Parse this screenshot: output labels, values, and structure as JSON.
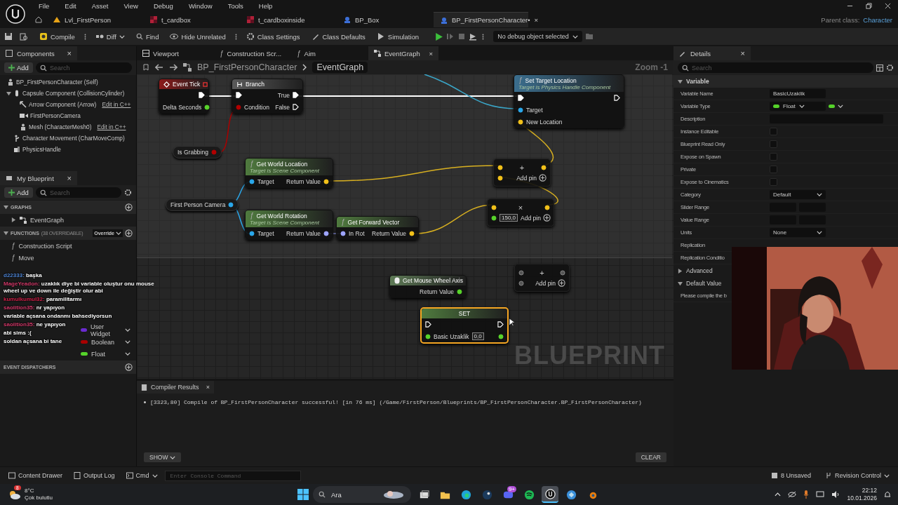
{
  "menu": [
    "File",
    "Edit",
    "Asset",
    "View",
    "Debug",
    "Window",
    "Tools",
    "Help"
  ],
  "doc_tabs": [
    {
      "label": "Lvl_FirstPerson",
      "kind": "level",
      "selected": false
    },
    {
      "label": "t_cardbox",
      "kind": "texture",
      "selected": false
    },
    {
      "label": "t_cardboxinside",
      "kind": "texture",
      "selected": false
    },
    {
      "label": "BP_Box",
      "kind": "blueprint",
      "selected": false
    },
    {
      "label": "BP_FirstPersonCharacter•",
      "kind": "blueprint",
      "selected": true,
      "close": "×"
    }
  ],
  "parent_class": {
    "label": "Parent class:",
    "value": "Character"
  },
  "toolbar": {
    "compile": "Compile",
    "diff": "Diff",
    "find": "Find",
    "hide_unrelated": "Hide Unrelated",
    "class_settings": "Class Settings",
    "class_defaults": "Class Defaults",
    "simulation": "Simulation",
    "debug_object": "No debug object selected"
  },
  "components": {
    "title": "Components",
    "close": "×",
    "add": "Add",
    "search_placeholder": "Search",
    "tree": [
      {
        "label": "BP_FirstPersonCharacter (Self)",
        "kind": "self",
        "children": [
          {
            "label": "Capsule Component (CollisionCylinder)",
            "kind": "capsule",
            "expanded": true,
            "children": [
              {
                "label": "Arrow Component (Arrow)",
                "kind": "arrow",
                "action": "Edit in C++"
              },
              {
                "label": "FirstPersonCamera",
                "kind": "camera"
              },
              {
                "label": "Mesh (CharacterMesh0)",
                "kind": "mesh",
                "action": "Edit in C++"
              }
            ]
          },
          {
            "label": "Character Movement (CharMoveComp)",
            "kind": "movement"
          },
          {
            "label": "PhysicsHandle",
            "kind": "handle"
          }
        ]
      }
    ]
  },
  "editor_tabs": [
    {
      "label": "Viewport",
      "kind": "viewport",
      "selected": false
    },
    {
      "label": "Construction Scr...",
      "kind": "function",
      "icon": "ƒ",
      "selected": false
    },
    {
      "label": "Aim",
      "kind": "function",
      "icon": "ƒ",
      "selected": false
    },
    {
      "label": "EventGraph",
      "kind": "graph",
      "selected": true,
      "close": "×"
    }
  ],
  "breadcrumb": [
    "BP_FirstPersonCharacter",
    "EventGraph"
  ],
  "zoom_label": "Zoom -1",
  "watermark": "BLUEPRINT",
  "graph": {
    "nodes": [
      {
        "kind": "event",
        "title": "Event Tick",
        "rows": [
          {
            "out": {
              "kind": "exec",
              "linked": true
            }
          },
          {
            "out": {
              "kind": "float",
              "label": "Delta Seconds"
            }
          }
        ]
      },
      {
        "kind": "branch",
        "title": "Branch",
        "rows": [
          {
            "in": {
              "kind": "exec",
              "linked": true
            },
            "out": {
              "kind": "exec",
              "label": "True",
              "linked": true
            }
          },
          {
            "in": {
              "kind": "bool",
              "label": "Condition"
            },
            "out": {
              "kind": "exec",
              "label": "False",
              "linked": false
            }
          }
        ]
      },
      {
        "kind": "call",
        "icon": "ƒ",
        "title": "Set Target Location",
        "subtitle": "Target is Physics Handle Component",
        "rows": [
          {
            "in": {
              "kind": "exec",
              "linked": true
            },
            "out": {
              "kind": "exec",
              "linked": false
            }
          },
          {
            "in": {
              "kind": "object",
              "label": "Target"
            }
          },
          {
            "in": {
              "kind": "vector",
              "label": "New Location"
            }
          }
        ]
      },
      {
        "kind": "variable",
        "title": "Is Grabbing",
        "rows": [
          {
            "out": {
              "kind": "bool"
            }
          }
        ]
      },
      {
        "kind": "pure",
        "icon": "ƒ",
        "title": "Get World Location",
        "subtitle": "Target is Scene Component",
        "rows": [
          {
            "in": {
              "kind": "object",
              "label": "Target"
            },
            "out": {
              "kind": "vector",
              "label": "Return Value"
            }
          }
        ]
      },
      {
        "kind": "variable",
        "title": "First Person Camera",
        "rows": [
          {
            "out": {
              "kind": "object"
            }
          }
        ]
      },
      {
        "kind": "pure",
        "icon": "ƒ",
        "title": "Get World Rotation",
        "subtitle": "Target is Scene Component",
        "rows": [
          {
            "in": {
              "kind": "object",
              "label": "Target"
            },
            "out": {
              "kind": "rotator",
              "label": "Return Value"
            }
          }
        ]
      },
      {
        "kind": "pure",
        "icon": "ƒ",
        "title": "Get Forward Vector",
        "rows": [
          {
            "in": {
              "kind": "rotator",
              "label": "In Rot"
            },
            "out": {
              "kind": "vector",
              "label": "Return Value"
            }
          }
        ]
      },
      {
        "kind": "math",
        "operator": "+",
        "add_pin": "Add pin",
        "rows": [
          {
            "in": {
              "kind": "vector"
            },
            "out": {
              "kind": "vector"
            }
          },
          {
            "in": {
              "kind": "vector"
            }
          }
        ]
      },
      {
        "kind": "math",
        "operator": "×",
        "add_pin": "Add pin",
        "rows": [
          {
            "in": {
              "kind": "vector"
            },
            "out": {
              "kind": "vector"
            }
          },
          {
            "in": {
              "kind": "float",
              "value": "150,0"
            }
          }
        ]
      },
      {
        "kind": "input",
        "title": "Get Mouse Wheel Axis",
        "rows": [
          {
            "out": {
              "kind": "float",
              "label": "Return Value"
            }
          }
        ]
      },
      {
        "kind": "math",
        "operator": "+",
        "add_pin": "Add pin",
        "rows": [
          {
            "in": {
              "kind": "wildcard"
            },
            "out": {
              "kind": "wildcard"
            }
          },
          {
            "in": {
              "kind": "wildcard"
            }
          }
        ]
      },
      {
        "kind": "set",
        "title": "SET",
        "selected": true,
        "rows": [
          {
            "in": {
              "kind": "exec",
              "linked": false
            },
            "out": {
              "kind": "exec",
              "linked": false
            }
          },
          {
            "in": {
              "kind": "float",
              "label": "Basic Uzaklik",
              "value": "0,0"
            },
            "out": {
              "kind": "float"
            }
          }
        ]
      }
    ]
  },
  "my_blueprint": {
    "title": "My Blueprint",
    "close": "×",
    "add": "Add",
    "search_placeholder": "Search",
    "sections": [
      {
        "title": "GRAPHS",
        "expanded": true,
        "items": [
          {
            "label": "EventGraph",
            "kind": "graph",
            "expanded": false
          }
        ]
      },
      {
        "title": "FUNCTIONS",
        "note": "(38 OVERRIDABLE)",
        "dropdown": "Override",
        "expanded": true,
        "items": [
          {
            "label": "Construction Script",
            "kind": "function",
            "icon": "ƒ"
          },
          {
            "label": "Move",
            "kind": "function",
            "icon": "ƒ"
          }
        ]
      }
    ],
    "variables": [
      {
        "type": "User Widget",
        "color": "#6a2bd0"
      },
      {
        "type": "Boolean",
        "color": "#a80000"
      },
      {
        "type": "Float",
        "color": "#55d22a"
      }
    ],
    "event_dispatchers": "EVENT DISPATCHERS"
  },
  "chat": [
    {
      "user": "d22333:",
      "text": "başka",
      "color": "#4f86d6"
    },
    {
      "user": "MageYeadon:",
      "text": "uzaklık diye bi variable oluştur onu mouse wheel up ve down ile değiştir olur abi",
      "color": "#d23a6a"
    },
    {
      "user": "kumulkumul32:",
      "text": "paramilitarmı",
      "color": "#d2204a"
    },
    {
      "user": "saolition35:",
      "text": "nr yapıyon",
      "color": "#d23a6a"
    },
    {
      "text": "variable açsana ondanmı bahsediyorsun"
    },
    {
      "user": "saolition35:",
      "text": "ne yapıyon",
      "color": "#d23a6a"
    },
    {
      "text": "abi sims :("
    },
    {
      "text": "soldan açsana bi tane"
    }
  ],
  "details": {
    "title": "Details",
    "close": "×",
    "search_placeholder": "Search",
    "sections": [
      {
        "title": "Variable",
        "expanded": true,
        "rows": [
          {
            "label": "Variable Name",
            "kind": "text",
            "value": "BasicUzaklik"
          },
          {
            "label": "Variable Type",
            "kind": "type",
            "value": "Float",
            "color": "#55d22a"
          },
          {
            "label": "Description",
            "kind": "wide"
          },
          {
            "label": "Instance Editable",
            "kind": "checkbox",
            "checked": false
          },
          {
            "label": "Blueprint Read Only",
            "kind": "checkbox",
            "checked": false
          },
          {
            "label": "Expose on Spawn",
            "kind": "checkbox",
            "checked": false
          },
          {
            "label": "Private",
            "kind": "checkbox",
            "checked": false
          },
          {
            "label": "Expose to Cinematics",
            "kind": "checkbox",
            "checked": false
          },
          {
            "label": "Category",
            "kind": "dropdown",
            "value": "Default"
          },
          {
            "label": "Slider Range",
            "kind": "range"
          },
          {
            "label": "Value Range",
            "kind": "range"
          },
          {
            "label": "Units",
            "kind": "dropdown",
            "value": "None"
          },
          {
            "label": "Replication",
            "kind": "label"
          },
          {
            "label": "Replication Conditio",
            "kind": "label"
          }
        ]
      },
      {
        "title": "Advanced",
        "expanded": false
      },
      {
        "title": "Default Value",
        "expanded": true,
        "rows": [
          {
            "label": "Please compile the b",
            "kind": "label"
          }
        ]
      }
    ]
  },
  "compiler": {
    "title": "Compiler Results",
    "close": "×",
    "messages": [
      "[3323,80] Compile of BP_FirstPersonCharacter successful! [in 76 ms] (/Game/FirstPerson/Blueprints/BP_FirstPersonCharacter.BP_FirstPersonCharacter)"
    ],
    "show": "SHOW",
    "clear": "CLEAR"
  },
  "status_bar": {
    "content_drawer": "Content Drawer",
    "output_log": "Output Log",
    "cmd": "Cmd",
    "console_placeholder": "Enter Console Command",
    "unsaved": "8 Unsaved",
    "revision_control": "Revision Control"
  },
  "taskbar": {
    "weather_badge": "8",
    "temperature": "8°C",
    "weather": "Çok bulutlu",
    "search_placeholder": "Ara",
    "apps": [
      {
        "kind": "taskview",
        "selected": false
      },
      {
        "kind": "folder",
        "selected": false
      },
      {
        "kind": "browser",
        "selected": false
      },
      {
        "kind": "steam",
        "selected": false
      },
      {
        "kind": "chat",
        "selected": false,
        "badge": "9+"
      },
      {
        "kind": "music",
        "selected": false
      },
      {
        "kind": "engine",
        "selected": true
      },
      {
        "kind": "blue",
        "selected": false
      },
      {
        "kind": "blender",
        "selected": false
      }
    ],
    "time": "22:12",
    "date": "10.01.2026"
  }
}
